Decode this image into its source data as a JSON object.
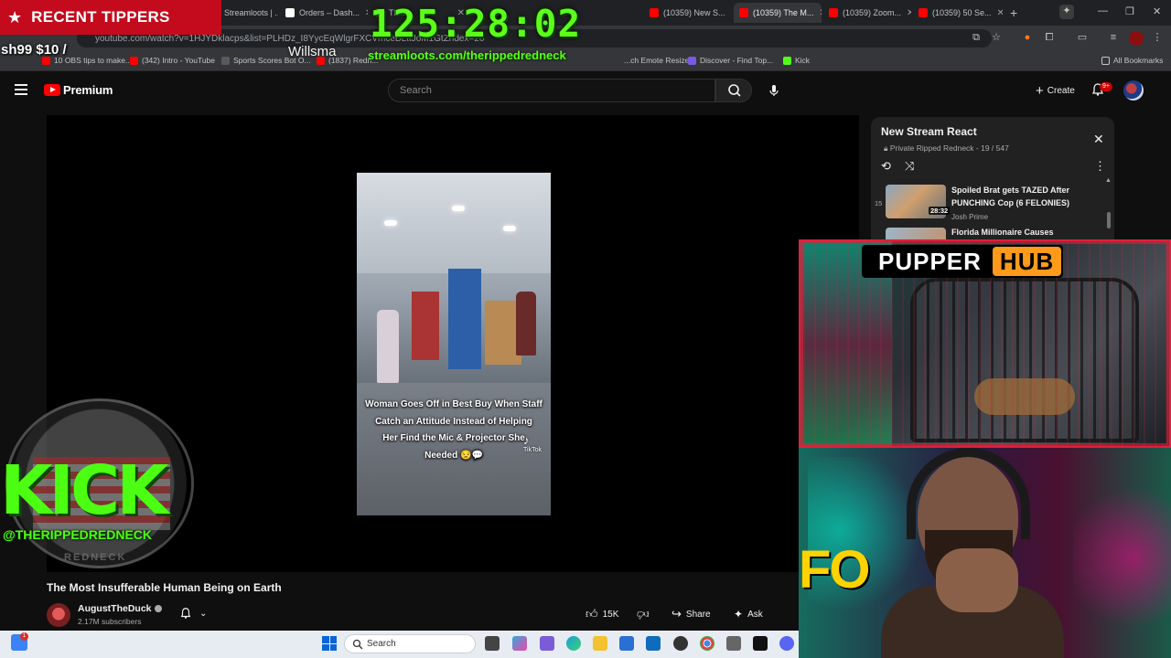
{
  "browser": {
    "tabs": [
      {
        "label": "Streamloots | ..."
      },
      {
        "label": "Orders – Dash..."
      },
      {
        "label": "The..."
      },
      {
        "label": "(10359) New S..."
      },
      {
        "label": "(10359) The M..."
      },
      {
        "label": "(10359) Zoom..."
      },
      {
        "label": "(10359) 50 Se..."
      }
    ],
    "new_tab": "+",
    "url": "youtube.com/watch?v=1HJYDklacps&list=PLHDz_I8YycEqWlgrFXCVmceBLttJoM1GtZndex=20",
    "bookmarks": [
      {
        "label": "10 OBS tips to make..."
      },
      {
        "label": "(342) Intro - YouTube"
      },
      {
        "label": "Sports Scores Bot O..."
      },
      {
        "label": "(1837) Redn..."
      },
      {
        "label": "...ch Emote Resizer"
      },
      {
        "label": "Discover - Find Top..."
      },
      {
        "label": "Kick"
      }
    ],
    "all_bookmarks": "All Bookmarks"
  },
  "youtube": {
    "logo_word": "Premium",
    "search_placeholder": "Search",
    "create_label": "Create",
    "notif_badge": "9+",
    "video": {
      "caption_lines": [
        "Woman Goes Off in Best Buy When Staff",
        "Catch an Attitude Instead of Helping",
        "Her Find the Mic & Projector She",
        "Needed 😒💬"
      ],
      "watermark": "TikTok",
      "title": "The Most Insufferable Human Being on Earth"
    },
    "channel": {
      "name": "AugustTheDuck",
      "subscribers": "2.17M subscribers"
    },
    "actions": {
      "likes": "15K",
      "share": "Share",
      "ask": "Ask"
    },
    "playlist": {
      "title": "New Stream React",
      "subtitle": "Private Ripped Redneck - 19 / 547",
      "items": [
        {
          "index": "15",
          "title": "Spoiled Brat gets TAZED After PUNCHING Cop (6 FELONIES)",
          "channel": "Josh Prime",
          "duration": "28:32"
        },
        {
          "index": "",
          "title": "Florida Millionaire Causes",
          "channel": "",
          "duration": ""
        }
      ]
    }
  },
  "overlay": {
    "tippers_label": "RECENT TIPPERS",
    "tipper_amount": "sh99 $10 /",
    "tipper_name": "Willsma",
    "timer": "125:28:02",
    "timer_url": "streamloots.com/therippedredneck",
    "kick_word": "KICK",
    "kick_handle": "@THERIPPEDREDNECK",
    "kick_sub": "REDNECK",
    "pupper_word1": "PUPPER",
    "pupper_word2": "HUB",
    "fo_text": "FO"
  },
  "taskbar": {
    "search_placeholder": "Search",
    "widget_badge": "1"
  }
}
